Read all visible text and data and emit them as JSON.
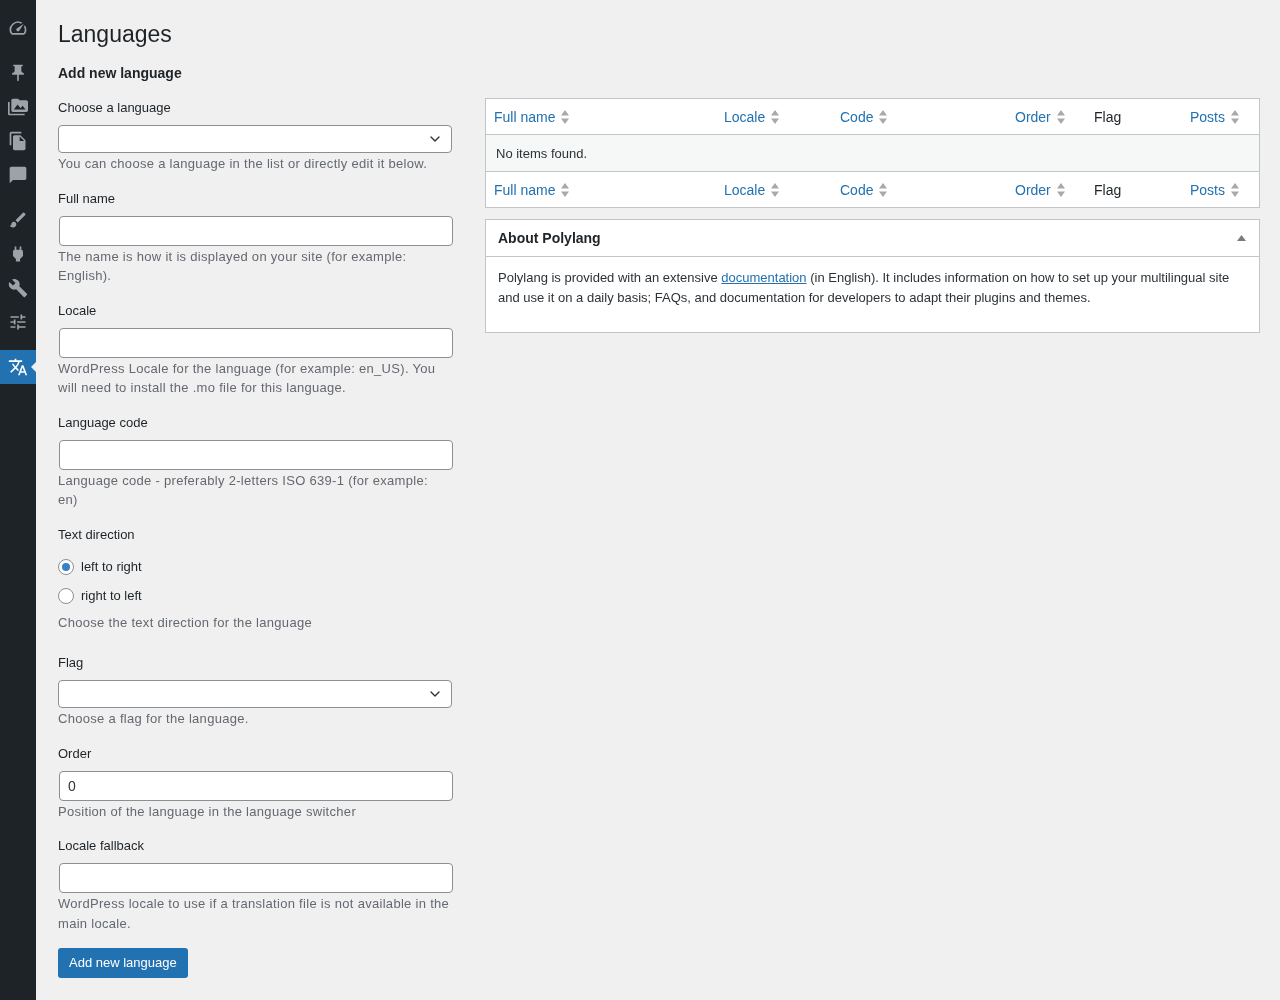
{
  "sidebar": {
    "groups": [
      {
        "items": [
          {
            "selected": false
          }
        ]
      },
      {
        "items": [
          {
            "selected": false
          },
          {
            "selected": false
          },
          {
            "selected": false
          },
          {
            "selected": false
          }
        ]
      },
      {
        "items": [
          {
            "selected": false
          },
          {
            "selected": false
          },
          {
            "selected": false
          },
          {
            "selected": false
          }
        ]
      },
      {
        "items": [
          {
            "selected": true
          }
        ]
      }
    ]
  },
  "page": {
    "title": "Languages"
  },
  "form": {
    "heading": "Add new language",
    "fields": [
      {
        "kind": "select",
        "label": "Choose a language",
        "description": "You can choose a language in the list or directly edit it below."
      },
      {
        "kind": "text",
        "label": "Full name",
        "description": "The name is how it is displayed on your site (for example: English)."
      },
      {
        "kind": "text",
        "label": "Locale",
        "description": "WordPress Locale for the language (for example: en_US). You will need to install the .mo file for this language."
      },
      {
        "kind": "text",
        "label": "Language code",
        "description": "Language code - preferably 2-letters ISO 639-1 (for example: en)"
      },
      {
        "kind": "radio",
        "label": "Text direction",
        "options": [
          {
            "label": "left to right",
            "selected": true
          },
          {
            "label": "right to left",
            "selected": false
          }
        ],
        "description": "Choose the text direction for the language"
      },
      {
        "kind": "select",
        "label": "Flag",
        "description": "Choose a flag for the language."
      },
      {
        "kind": "text",
        "label": "Order",
        "value": "0",
        "description": "Position of the language in the language switcher"
      },
      {
        "kind": "text",
        "label": "Locale fallback",
        "description": "WordPress locale to use if a translation file is not available in the main locale."
      }
    ],
    "submit": "Add new language"
  },
  "table": {
    "header_columns": [
      {
        "label": "Full name",
        "sortable": true
      },
      {
        "label": "Locale",
        "sortable": true
      },
      {
        "label": "Code",
        "sortable": true
      },
      {
        "label": "Order",
        "sortable": true
      },
      {
        "label": "Flag",
        "sortable": false
      },
      {
        "label": "Posts",
        "sortable": true
      }
    ],
    "empty_message": "No items found.",
    "footer_columns": [
      {
        "label": "Full name",
        "sortable": true
      },
      {
        "label": "Locale",
        "sortable": true
      },
      {
        "label": "Code",
        "sortable": true
      },
      {
        "label": "Order",
        "sortable": true
      },
      {
        "label": "Flag",
        "sortable": false
      },
      {
        "label": "Posts",
        "sortable": true
      }
    ]
  },
  "about": {
    "title": "About Polylang",
    "expanded": true,
    "text_before": "Polylang is provided with an extensive ",
    "link": "documentation",
    "text_after": " (in English). It includes information on how to set up your multilingual site and use it on a daily basis; FAQs, and documentation for developers to adapt their plugins and themes."
  }
}
